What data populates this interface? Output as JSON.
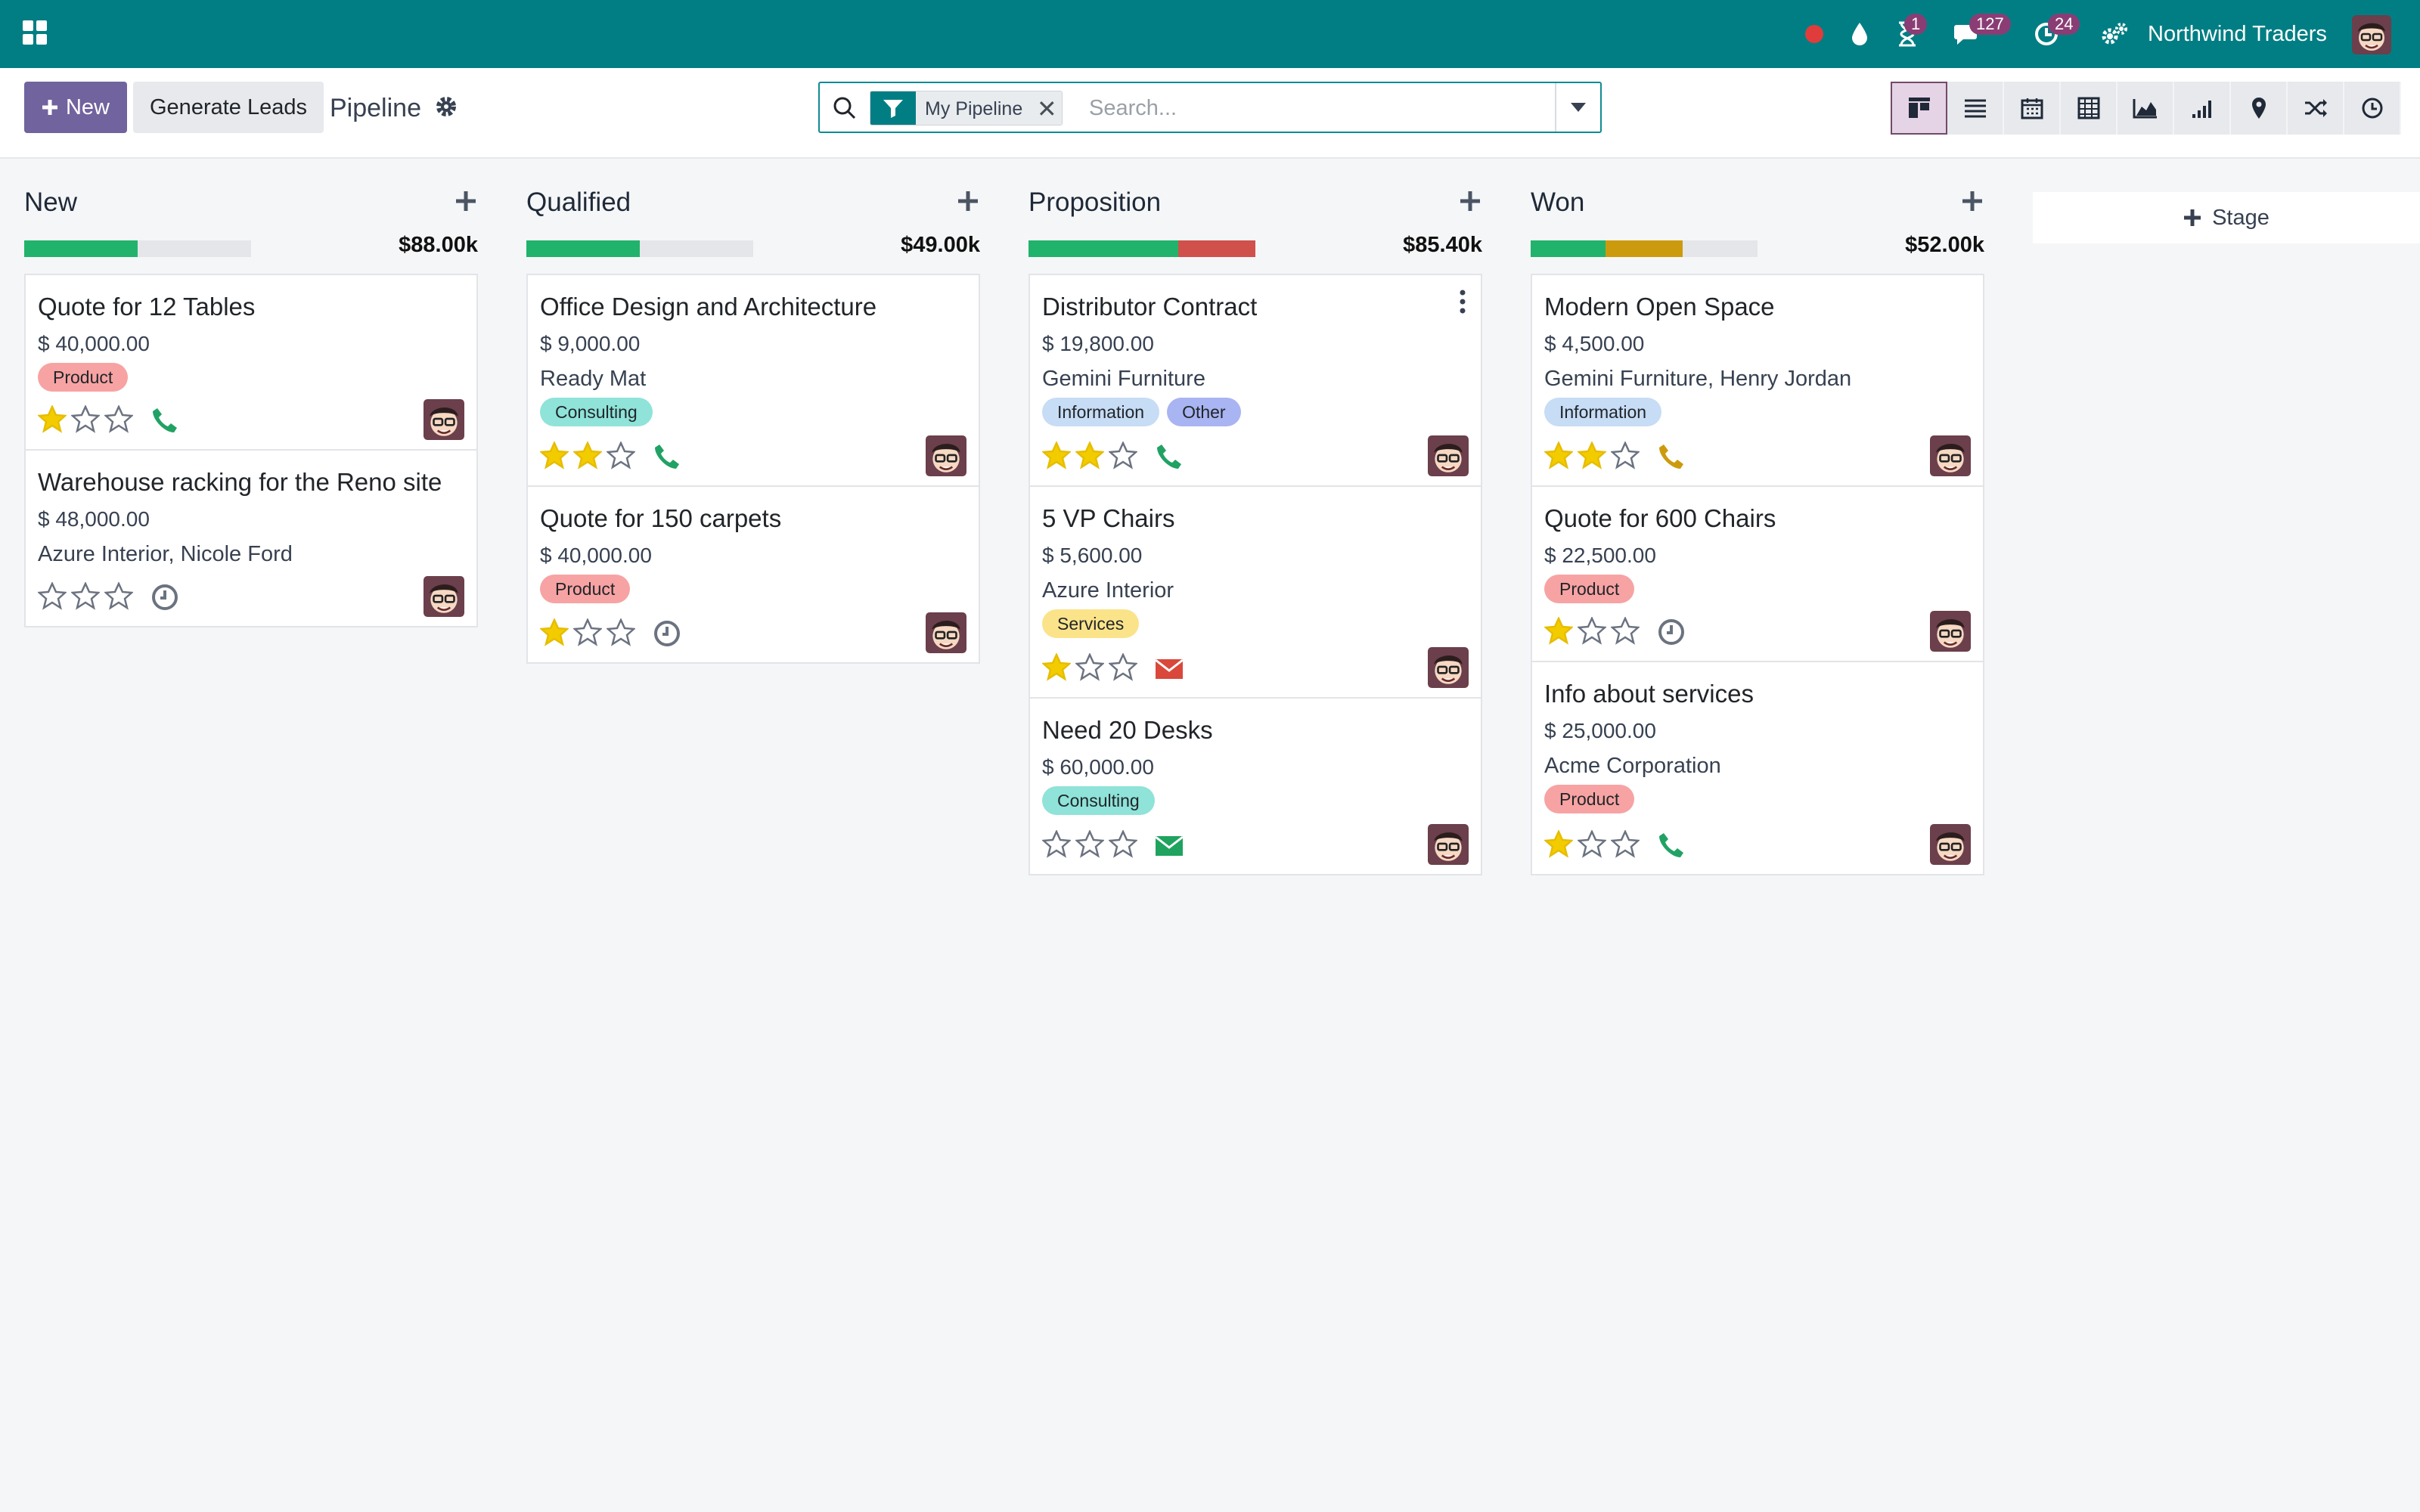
{
  "topbar": {
    "company": "Northwind Traders",
    "badges": {
      "activities": "1",
      "messages": "127",
      "timesheet": "24"
    },
    "colors": {
      "bg": "#017e84",
      "badge": "#8a3d74",
      "record_dot": "#e03c3c"
    }
  },
  "control": {
    "new_label": "New",
    "generate_label": "Generate Leads",
    "breadcrumb": "Pipeline",
    "facet_label": "My Pipeline",
    "facet_remove": "✕",
    "search_placeholder": "Search..."
  },
  "add_stage_label": "Stage",
  "columns": [
    {
      "title": "New",
      "total": "$88.00k",
      "progress": [
        {
          "color": "#21b36b",
          "pct": 50
        }
      ],
      "cards": [
        {
          "title": "Quote for 12 Tables",
          "amount": "$ 40,000.00",
          "partner": "",
          "tags": [
            {
              "label": "Product",
              "color": "#f7a3a3"
            }
          ],
          "stars": 1,
          "activity": "phone",
          "activity_color": "#21a264"
        },
        {
          "title": "Warehouse racking for the Reno site",
          "amount": "$ 48,000.00",
          "partner": "Azure Interior, Nicole Ford",
          "tags": [],
          "stars": 0,
          "activity": "clock",
          "activity_color": "#6b7280"
        }
      ]
    },
    {
      "title": "Qualified",
      "total": "$49.00k",
      "progress": [
        {
          "color": "#21b36b",
          "pct": 50
        }
      ],
      "cards": [
        {
          "title": "Office Design and Architecture",
          "amount": "$ 9,000.00",
          "partner": "Ready Mat",
          "tags": [
            {
              "label": "Consulting",
              "color": "#8fe3d9"
            }
          ],
          "stars": 2,
          "activity": "phone",
          "activity_color": "#21a264"
        },
        {
          "title": "Quote for 150 carpets",
          "amount": "$ 40,000.00",
          "partner": "",
          "tags": [
            {
              "label": "Product",
              "color": "#f7a3a3"
            }
          ],
          "stars": 1,
          "activity": "clock",
          "activity_color": "#6b7280"
        }
      ]
    },
    {
      "title": "Proposition",
      "total": "$85.40k",
      "progress": [
        {
          "color": "#21b36b",
          "pct": 66
        },
        {
          "color": "#d0504b",
          "pct": 34
        }
      ],
      "cards": [
        {
          "title": "Distributor Contract",
          "amount": "$ 19,800.00",
          "partner": "Gemini Furniture",
          "tags": [
            {
              "label": "Information",
              "color": "#c7dcf5"
            },
            {
              "label": "Other",
              "color": "#a9b4f2"
            }
          ],
          "stars": 2,
          "activity": "phone",
          "activity_color": "#21a264",
          "menu": true
        },
        {
          "title": "5 VP Chairs",
          "amount": "$ 5,600.00",
          "partner": "Azure Interior",
          "tags": [
            {
              "label": "Services",
              "color": "#fbe38a"
            }
          ],
          "stars": 1,
          "activity": "mail",
          "activity_color": "#d9483b"
        },
        {
          "title": "Need 20 Desks",
          "amount": "$ 60,000.00",
          "partner": "",
          "tags": [
            {
              "label": "Consulting",
              "color": "#8fe3d9"
            }
          ],
          "stars": 0,
          "activity": "mail",
          "activity_color": "#1fa35f"
        }
      ]
    },
    {
      "title": "Won",
      "total": "$52.00k",
      "progress": [
        {
          "color": "#21b36b",
          "pct": 33
        },
        {
          "color": "#cc9b0d",
          "pct": 34
        }
      ],
      "cards": [
        {
          "title": "Modern Open Space",
          "amount": "$ 4,500.00",
          "partner": "Gemini Furniture, Henry Jordan",
          "tags": [
            {
              "label": "Information",
              "color": "#c7dcf5"
            }
          ],
          "stars": 2,
          "activity": "phone",
          "activity_color": "#cc9b0d"
        },
        {
          "title": "Quote for 600 Chairs",
          "amount": "$ 22,500.00",
          "partner": "",
          "tags": [
            {
              "label": "Product",
              "color": "#f7a3a3"
            }
          ],
          "stars": 1,
          "activity": "clock",
          "activity_color": "#6b7280"
        },
        {
          "title": "Info about services",
          "amount": "$ 25,000.00",
          "partner": "Acme Corporation",
          "tags": [
            {
              "label": "Product",
              "color": "#f7a3a3"
            }
          ],
          "stars": 1,
          "activity": "phone",
          "activity_color": "#21a264"
        }
      ]
    }
  ]
}
